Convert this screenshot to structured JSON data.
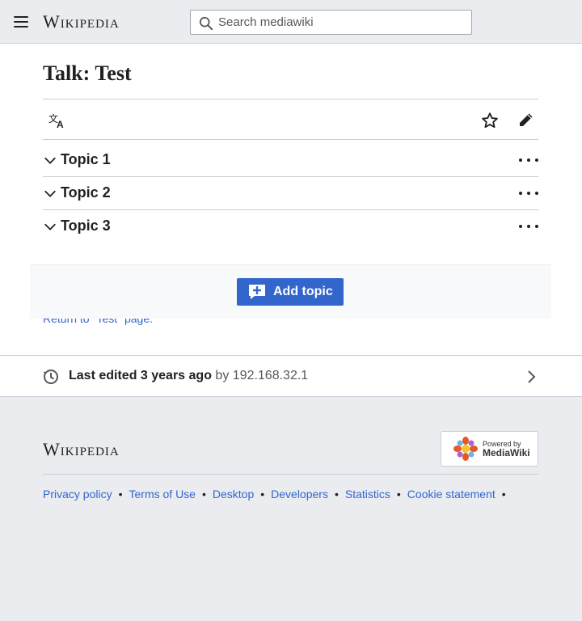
{
  "header": {
    "wordmark": "Wikipedia",
    "search_placeholder": "Search mediawiki"
  },
  "page": {
    "title_ns": "Talk",
    "title_sep": ":",
    "title_name": " Test"
  },
  "toolbar": {
    "language_label": "Language",
    "watch_label": "Watch",
    "edit_label": "Edit"
  },
  "topics": [
    {
      "label": "Topic 1"
    },
    {
      "label": "Topic 2"
    },
    {
      "label": "Topic 3"
    }
  ],
  "return_link": "Return to \"Test\" page.",
  "add_topic_label": "Add topic",
  "last_edited": {
    "prefix": "Last edited 3 years ago",
    "by": " by ",
    "user": "192.168.32.1"
  },
  "footer": {
    "wordmark": "Wikipedia",
    "powered_small": "Powered by",
    "powered_big": "MediaWiki",
    "links": [
      "Privacy policy",
      "Terms of Use",
      "Desktop",
      "Developers",
      "Statistics",
      "Cookie statement"
    ]
  },
  "colors": {
    "accent": "#3366cc",
    "chrome": "#eaecf0",
    "border": "#c8ccd1"
  }
}
